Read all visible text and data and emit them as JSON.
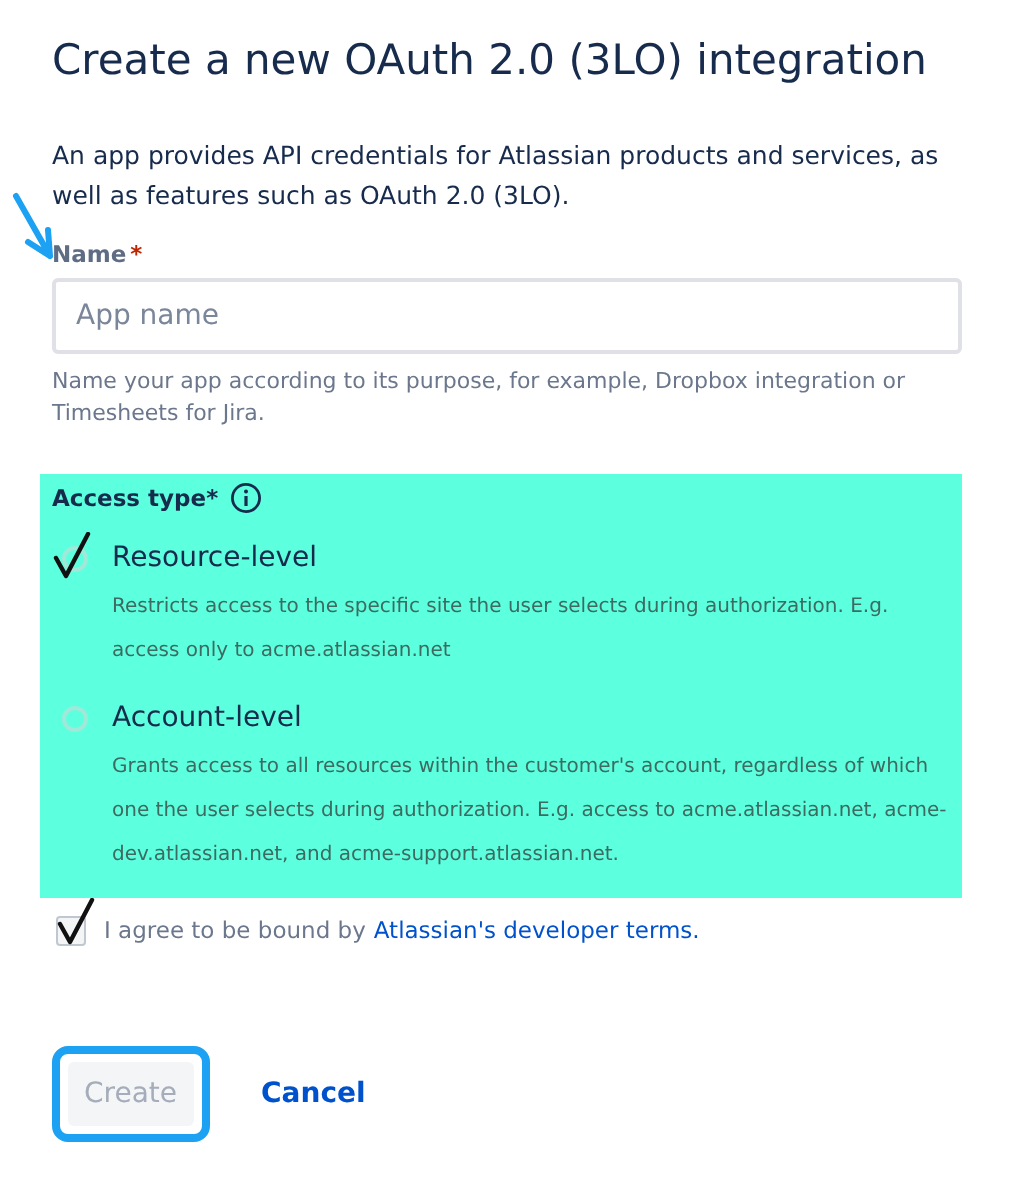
{
  "title": "Create a new OAuth 2.0 (3LO) integration",
  "intro": "An app provides API credentials for Atlassian products and services, as well as features such as OAuth 2.0 (3LO).",
  "name_field": {
    "label": "Name",
    "required_mark": "*",
    "placeholder": "App name",
    "help": "Name your app according to its purpose, for example, Dropbox integration or Timesheets for Jira."
  },
  "access_type": {
    "label": "Access type",
    "required_mark": "*",
    "options": [
      {
        "label": "Resource-level",
        "description": "Restricts access to the specific site the user selects during authorization. E.g. access only to acme.atlassian.net",
        "selected": true
      },
      {
        "label": "Account-level",
        "description": "Grants access to all resources within the customer's account, regardless of which one the user selects during authorization. E.g. access to acme.atlassian.net, acme-dev.atlassian.net, and acme-support.atlassian.net.",
        "selected": false
      }
    ]
  },
  "agreement": {
    "checked": true,
    "text": "I agree to be bound by",
    "link": "Atlassian's developer terms."
  },
  "buttons": [
    {
      "kind": "primary",
      "label": "Create",
      "disabled": true
    },
    {
      "kind": "link",
      "label": "Cancel"
    }
  ]
}
